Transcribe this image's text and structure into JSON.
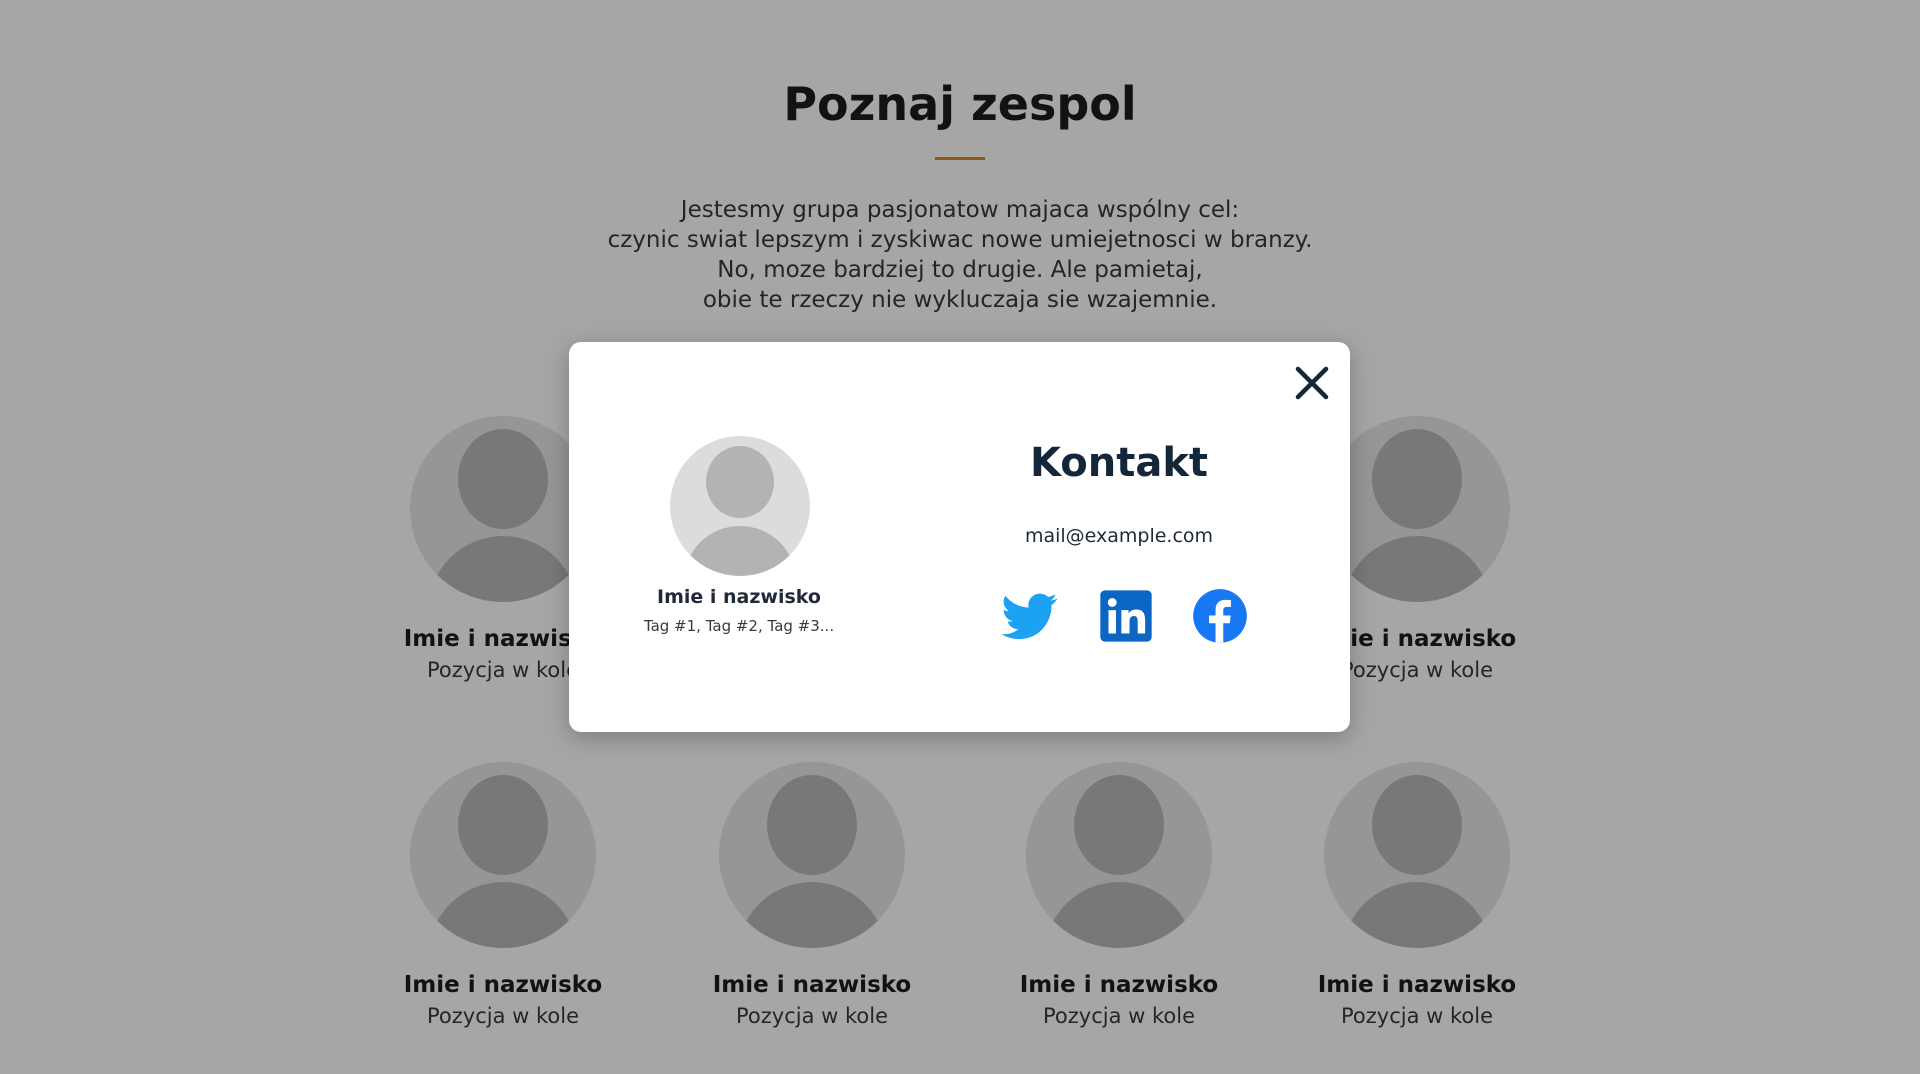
{
  "page": {
    "title": "Poznaj zespol",
    "intro_lines": [
      "Jestesmy grupa pasjonatow majaca wspólny cel:",
      "czynic swiat lepszym i zyskiwac nowe umiejetnosci w branzy.",
      "No, moze bardziej to drugie. Ale pamietaj,",
      "obie te rzeczy nie wykluczaja sie wzajemnie."
    ],
    "members": [
      {
        "name": "Imie i nazwisko",
        "role": "Pozycja w kole"
      },
      {
        "name": "Imie i nazwisko",
        "role": "Pozycja w kole"
      },
      {
        "name": "Imie i nazwisko",
        "role": "Pozycja w kole"
      },
      {
        "name": "Imie i nazwisko",
        "role": "Pozycja w kole"
      },
      {
        "name": "Imie i nazwisko",
        "role": "Pozycja w kole"
      },
      {
        "name": "Imie i nazwisko",
        "role": "Pozycja w kole"
      }
    ]
  },
  "modal": {
    "close_icon": "close-icon",
    "person_name": "Imie i nazwisko",
    "person_tags": "Tag #1, Tag #2, Tag #3...",
    "contact_title": "Kontakt",
    "email": "mail@example.com",
    "social": [
      {
        "icon": "twitter-icon",
        "color": "#1da1f2"
      },
      {
        "icon": "linkedin-icon",
        "color": "#0a66c2"
      },
      {
        "icon": "facebook-icon",
        "color": "#1877f2"
      }
    ]
  },
  "colors": {
    "accent": "#d98a16",
    "overlay": "rgba(0,0,0,0.35)",
    "heading_dark": "#13263a"
  }
}
